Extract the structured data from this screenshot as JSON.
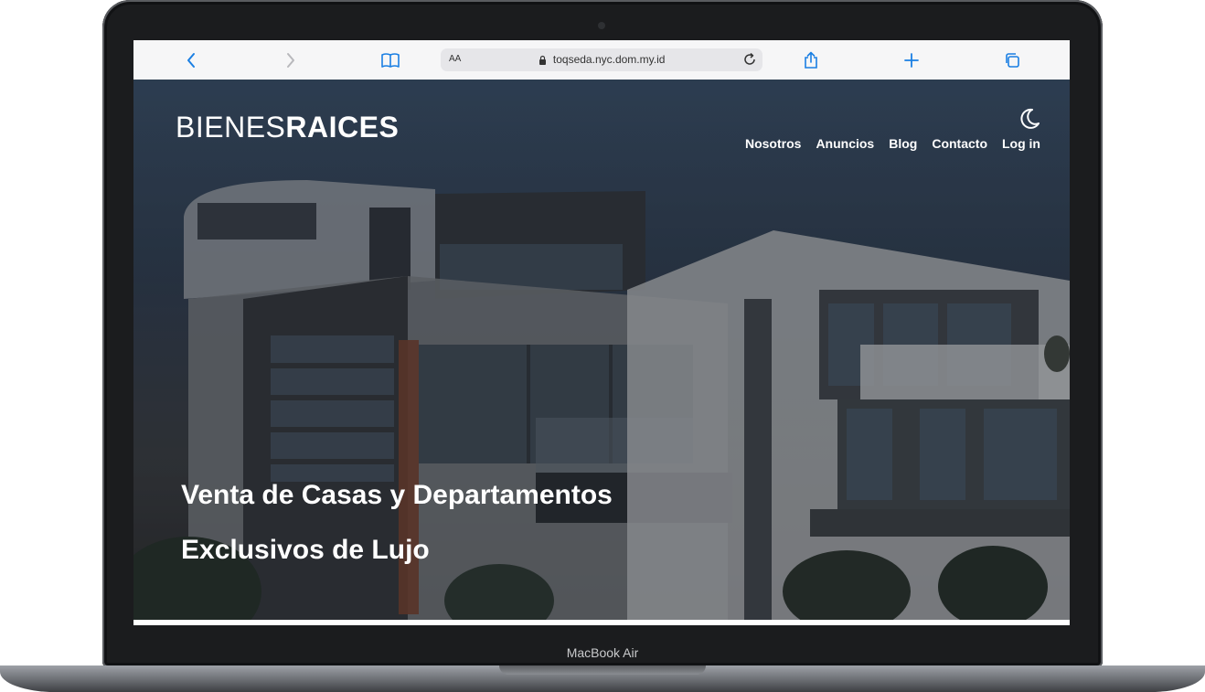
{
  "device": {
    "label": "MacBook Air"
  },
  "browser": {
    "text_size_label": "AA",
    "url": "toqseda.nyc.dom.my.id",
    "icons": [
      "chevron-left-icon",
      "chevron-right-icon",
      "book-icon",
      "lock-icon",
      "reload-icon",
      "share-icon",
      "plus-icon",
      "tabs-icon"
    ]
  },
  "site": {
    "logo": {
      "light": "BIENES",
      "bold": "RAICES"
    },
    "nav": [
      "Nosotros",
      "Anuncios",
      "Blog",
      "Contacto",
      "Log in"
    ],
    "theme_toggle_icon": "moon-icon",
    "headline_line1": "Venta de Casas y Departamentos",
    "headline_line2": "Exclusivos de Lujo"
  },
  "colors": {
    "accent_blue": "#1a7fe3",
    "hero_overlay": "#2d3f55",
    "text_light": "#ffffff"
  }
}
